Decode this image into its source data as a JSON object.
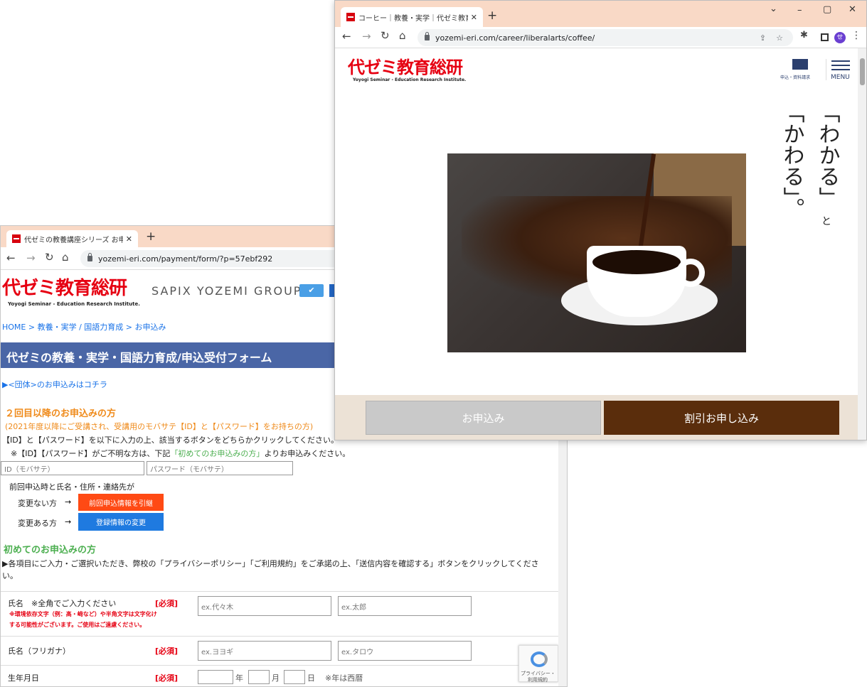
{
  "back_window": {
    "tab_title": "代ゼミの教養講座シリーズ お申込み",
    "new_tab": "+",
    "close": "✕",
    "url": "yozemi-eri.com/payment/form/?p=57ebf292",
    "logo_text": "代ゼミ教育総研",
    "logo_sub": "Yoyogi Seminar - Education Research Institute.",
    "group_text": "SAPIX YOZEMI GROUP",
    "breadcrumb": "HOME > 教養・実学 / 国語力育成 > お申込み",
    "page_title": "代ゼミの教養・実学・国語力育成/申込受付フォーム",
    "group_link": "▶<団体>のお申込みはコチラ",
    "section1": {
      "heading": "２回目以降のお申込みの方",
      "note": "(2021年度以降にご受講され、受講用のモバサテ【ID】と【パスワード】をお持ちの方)",
      "instruction": "【ID】と【パスワード】を以下に入力の上、該当するボタンをどちらかクリックしてください。",
      "hint_prefix": "※【ID】【パスワード】がご不明な方は、下記",
      "hint_link": "「初めてのお申込みの方」",
      "hint_suffix": "よりお申込みください。",
      "id_placeholder": "ID（モバサテ）",
      "pw_placeholder": "パスワード（モバサテ）",
      "prev_label": "前回申込時と氏名・住所・連絡先が",
      "unchanged_label": "変更ない方",
      "changed_label": "変更ある方",
      "arrow": "→",
      "inherit_button": "前回申込情報を引継",
      "change_button": "登録情報の変更"
    },
    "section2": {
      "heading": "初めてのお申込みの方",
      "instruction": "▶各項目にご入力・ご選択いただき、弊校の「プライバシーポリシー」「ご利用規約」をご承諾の上、「送信内容を確認する」ボタンをクリックしてくださ",
      "instruction_wrap": "い。"
    },
    "form": {
      "name_label": "氏名　※全角でご入力ください",
      "name_warn1": "※環境依存文字（例：髙・﨑など）や半角文字は文字化け",
      "name_warn2": "する可能性がございます。ご使用はご遠慮ください。",
      "required": "[必須]",
      "name_last_ph": "ex.代々木",
      "name_first_ph": "ex.太郎",
      "kana_label": "氏名（フリガナ）",
      "kana_last_ph": "ex.ヨヨギ",
      "kana_first_ph": "ex.タロウ",
      "birth_label": "生年月日",
      "year": "年",
      "month": "月",
      "day": "日",
      "era_note": "※年は西暦"
    },
    "recaptcha_text": "プライバシー・",
    "recaptcha_text2": "利用規約"
  },
  "front_window": {
    "tab_title": "コーヒー｜教養・実学｜代ゼミ教育総",
    "new_tab": "+",
    "close": "✕",
    "url": "yozemi-eri.com/career/liberalarts/coffee/",
    "logo_text": "代ゼミ教育総研",
    "logo_sub": "Yoyogi Seminar - Education Research Institute.",
    "mail_label": "申込・資料請求",
    "menu_label": "MENU",
    "vertical_col1": "「わかる」",
    "vertical_col2": "「かわる」。",
    "vertical_to": "と",
    "apply_button": "お申込み",
    "discount_button": "割引お申し込み",
    "min": "–",
    "max": "▢",
    "win_close": "✕",
    "dropdown": "⌄"
  },
  "colors": {
    "tab_bar": "#f9d9c6",
    "logo_red": "#e60012",
    "title_band": "#4a66a6",
    "orange": "#ef8a1a",
    "green": "#4caf50",
    "inherit_btn": "#ff4a14",
    "change_btn": "#1f7ae0",
    "discount_btn": "#5a2d0c",
    "apply_btn": "#c9c9c9"
  }
}
